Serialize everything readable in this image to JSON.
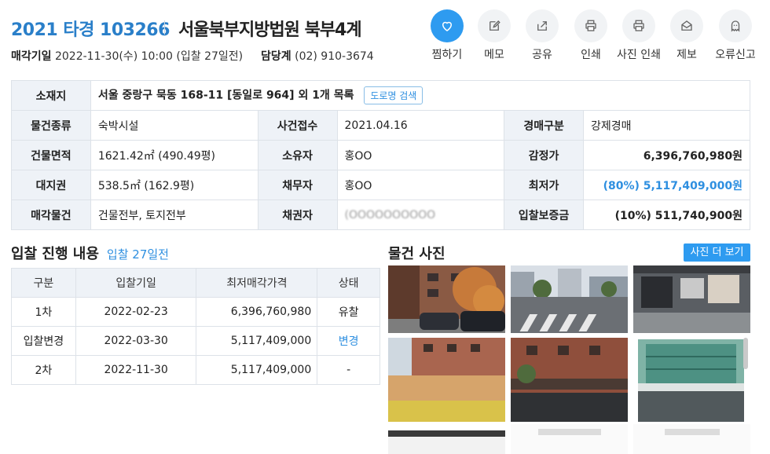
{
  "header": {
    "case_number": "2021 타경 103266",
    "court": "서울북부지방법원 북부4계",
    "sale_date_label": "매각기일",
    "sale_date_value": "2022-11-30(수) 10:00 (입찰 27일전)",
    "dept_label": "담당계",
    "dept_phone": "(02) 910-3674"
  },
  "actions": [
    {
      "label": "찜하기",
      "icon": "heart-icon"
    },
    {
      "label": "메모",
      "icon": "memo-icon"
    },
    {
      "label": "공유",
      "icon": "share-icon"
    },
    {
      "label": "인쇄",
      "icon": "print-icon"
    },
    {
      "label": "사진 인쇄",
      "icon": "print-icon"
    },
    {
      "label": "제보",
      "icon": "report-icon"
    },
    {
      "label": "오류신고",
      "icon": "error-report-icon"
    }
  ],
  "info": {
    "location_label": "소재지",
    "location_value": "서울 중랑구 묵동 168-11 [동일로 964] 외 1개 목록",
    "road_search": "도로명 검색",
    "rows": [
      [
        {
          "label": "물건종류",
          "value": "숙박시설"
        },
        {
          "label": "사건접수",
          "value": "2021.04.16"
        },
        {
          "label": "경매구분",
          "value": "강제경매"
        }
      ],
      [
        {
          "label": "건물면적",
          "value": "1621.42㎡ (490.49평)"
        },
        {
          "label": "소유자",
          "value": "홍OO"
        },
        {
          "label": "감정가",
          "value": "6,396,760,980원"
        }
      ],
      [
        {
          "label": "대지권",
          "value": "538.5㎡ (162.9평)"
        },
        {
          "label": "채무자",
          "value": "홍OO"
        },
        {
          "label": "최저가",
          "value": "(80%) 5,117,409,000원"
        }
      ],
      [
        {
          "label": "매각물건",
          "value": "건물전부, 토지전부"
        },
        {
          "label": "채권자",
          "value": "(OOOOOOOOOO"
        },
        {
          "label": "입찰보증금",
          "value": "(10%) 511,740,900원"
        }
      ]
    ]
  },
  "bid_section": {
    "title": "입찰 진행 내용",
    "subtitle": "입찰 27일전",
    "headers": [
      "구분",
      "입찰기일",
      "최저매각가격",
      "상태"
    ],
    "rows": [
      [
        "1차",
        "2022-02-23",
        "6,396,760,980",
        "유찰"
      ],
      [
        "입찰변경",
        "2022-03-30",
        "5,117,409,000",
        "변경"
      ],
      [
        "2차",
        "2022-11-30",
        "5,117,409,000",
        "-"
      ]
    ]
  },
  "photo_section": {
    "title": "물건 사진",
    "more_button": "사진 더 보기"
  },
  "colors": {
    "accent": "#2e8fe0",
    "header_bg": "#eef2f7",
    "border": "#dde2e8"
  }
}
